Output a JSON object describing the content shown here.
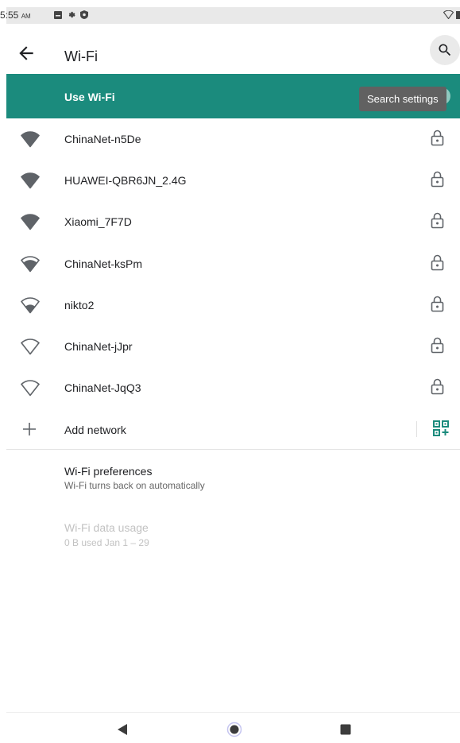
{
  "status_bar": {
    "time": "5:55",
    "ampm": "AM",
    "icons": [
      "notification-icon",
      "gear-icon",
      "shield-icon"
    ],
    "right_icons": [
      "wifi-signal-icon",
      "battery-icon"
    ]
  },
  "app_bar": {
    "title": "Wi-Fi",
    "back_icon": "arrow-back-icon",
    "search_icon": "search-icon"
  },
  "use_wifi": {
    "label": "Use Wi-Fi",
    "tooltip": "Search settings",
    "toggle_on": true
  },
  "networks": [
    {
      "name": "ChinaNet-n5De",
      "signal": 4,
      "secured": true
    },
    {
      "name": "HUAWEI-QBR6JN_2.4G",
      "signal": 4,
      "secured": true
    },
    {
      "name": "Xiaomi_7F7D",
      "signal": 4,
      "secured": true
    },
    {
      "name": "ChinaNet-ksPm",
      "signal": 3,
      "secured": true
    },
    {
      "name": "nikto2",
      "signal": 2,
      "secured": true
    },
    {
      "name": "ChinaNet-jJpr",
      "signal": 1,
      "secured": true
    },
    {
      "name": "ChinaNet-JqQ3",
      "signal": 1,
      "secured": true
    }
  ],
  "add_network": {
    "label": "Add network"
  },
  "preferences": {
    "title": "Wi-Fi preferences",
    "subtitle": "Wi-Fi turns back on automatically"
  },
  "data_usage": {
    "title": "Wi-Fi data usage",
    "subtitle": "0 B used Jan 1 – 29"
  },
  "colors": {
    "accent": "#1b8b7d",
    "icon": "#5f6368"
  }
}
